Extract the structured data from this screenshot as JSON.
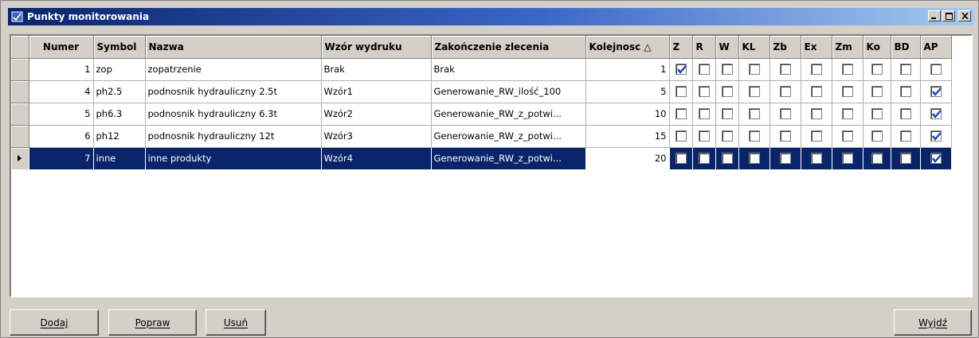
{
  "window": {
    "title": "Punkty monitorowania",
    "minimize_label": "_",
    "maximize_label": "□",
    "close_label": "×"
  },
  "table": {
    "columns": [
      "Numer",
      "Symbol",
      "Nazwa",
      "Wzór wydruku",
      "Zakończenie zlecenia",
      "Kolejnosc △",
      "Z",
      "R",
      "W",
      "KL",
      "Zb",
      "Ex",
      "Zm",
      "Ko",
      "BD",
      "AP"
    ],
    "rows": [
      {
        "numer": "1",
        "symbol": "zop",
        "nazwa": "zopatrzenie",
        "wzor": "Brak",
        "zakonczenie": "Brak",
        "kolejnosc": "1",
        "flags": [
          true,
          false,
          false,
          false,
          false,
          false,
          false,
          false,
          false,
          false
        ],
        "selected": false
      },
      {
        "numer": "4",
        "symbol": "ph2.5",
        "nazwa": "podnosnik hydrauliczny 2.5t",
        "wzor": "Wzór1",
        "zakonczenie": "Generowanie_RW_ilość_100",
        "kolejnosc": "5",
        "flags": [
          false,
          false,
          false,
          false,
          false,
          false,
          false,
          false,
          false,
          true
        ],
        "selected": false
      },
      {
        "numer": "5",
        "symbol": "ph6.3",
        "nazwa": "podnosnik hydrauliczny 6.3t",
        "wzor": "Wzór2",
        "zakonczenie": "Generowanie_RW_z_potwi...",
        "kolejnosc": "10",
        "flags": [
          false,
          false,
          false,
          false,
          false,
          false,
          false,
          false,
          false,
          true
        ],
        "selected": false
      },
      {
        "numer": "6",
        "symbol": "ph12",
        "nazwa": "podnosnik hydrauliczny 12t",
        "wzor": "Wzór3",
        "zakonczenie": "Generowanie_RW_z_potwi...",
        "kolejnosc": "15",
        "flags": [
          false,
          false,
          false,
          false,
          false,
          false,
          false,
          false,
          false,
          true
        ],
        "selected": false
      },
      {
        "numer": "7",
        "symbol": "inne",
        "nazwa": "inne produkty",
        "wzor": "Wzór4",
        "zakonczenie": "Generowanie_RW_z_potwi...",
        "kolejnosc": "20",
        "flags": [
          false,
          false,
          false,
          false,
          false,
          false,
          false,
          false,
          false,
          true
        ],
        "selected": true
      }
    ]
  },
  "buttons": {
    "add": "Dodaj",
    "edit": "Popraw",
    "delete": "Usuń",
    "exit": "Wyjdź"
  },
  "colors": {
    "title_start": "#0a246a",
    "title_end": "#a6caf0",
    "selection": "#0a246a",
    "check": "#1f3fbf"
  }
}
